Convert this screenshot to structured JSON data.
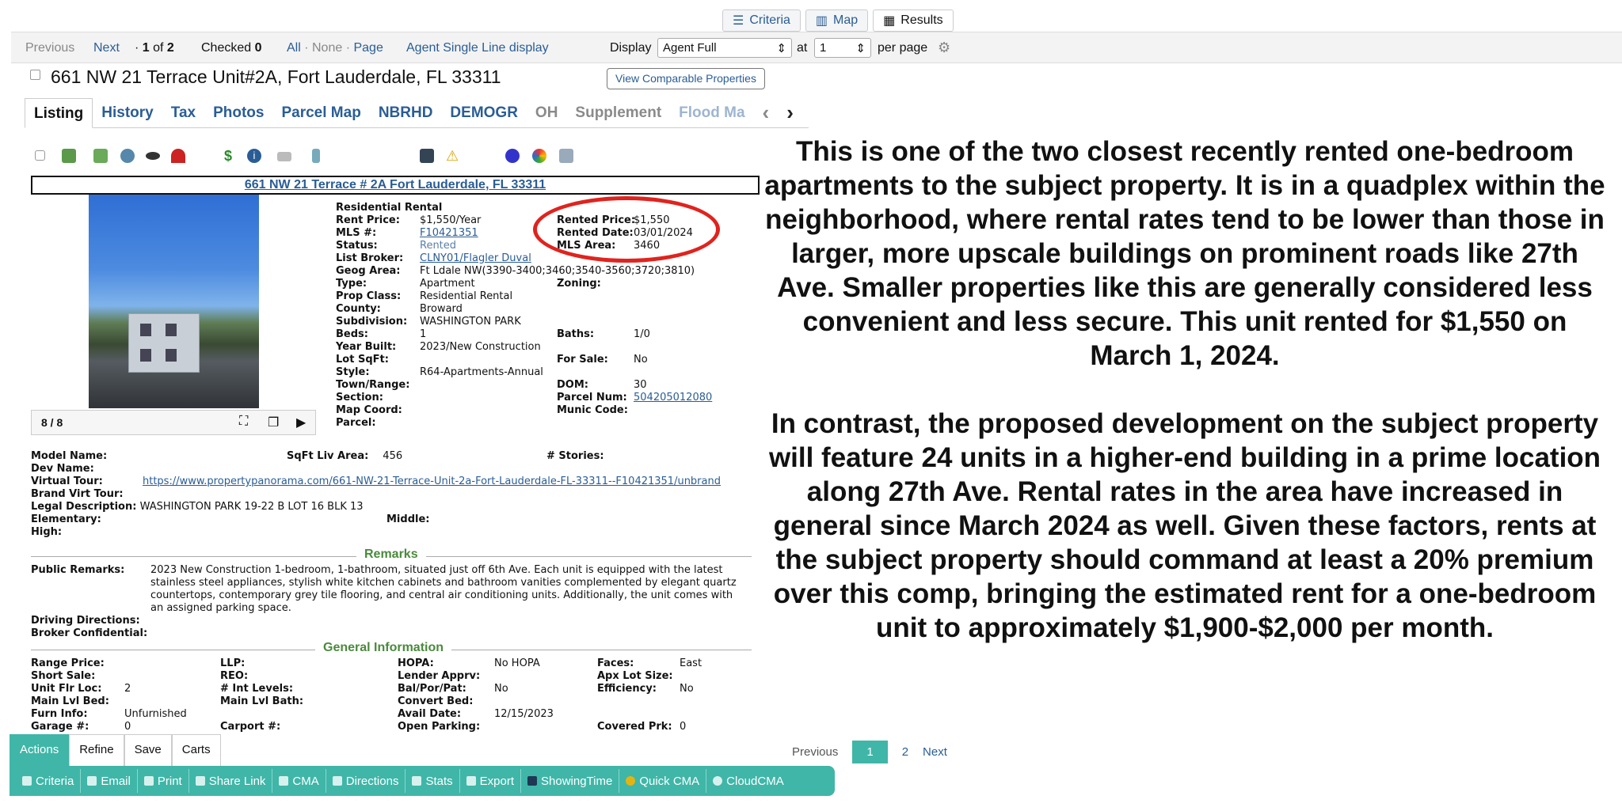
{
  "view_tabs": [
    {
      "label": "Criteria",
      "icon": "sliders-icon"
    },
    {
      "label": "Map",
      "icon": "map-icon"
    },
    {
      "label": "Results",
      "icon": "grid-icon"
    }
  ],
  "toolbar": {
    "previous": "Previous",
    "next": "Next",
    "position_prefix": "· ",
    "position_current": "1",
    "position_of": " of ",
    "position_total": "2",
    "checked_label": "Checked ",
    "checked_count": "0",
    "all": "All",
    "none": "None",
    "page": "Page",
    "sep": " · ",
    "single_line": "Agent Single Line display",
    "display_label": "Display",
    "display_value": "Agent Full",
    "at_label": "at",
    "per_page_value": "1",
    "per_page_label": "per page"
  },
  "listing": {
    "address": "661 NW 21 Terrace Unit#2A, Fort Lauderdale, FL 33311",
    "comparable_button": "View Comparable Properties",
    "tabs": [
      "Listing",
      "History",
      "Tax",
      "Photos",
      "Parcel Map",
      "NBRHD",
      "DEMOGR",
      "OH",
      "Supplement",
      "Flood Ma"
    ],
    "header_link": "661 NW 21 Terrace # 2A Fort Lauderdale, FL 33311",
    "photo_counter": "8 / 8",
    "type_heading": "Residential Rental",
    "col1": [
      {
        "k": "Rent Price:",
        "v": "$1,550/Year"
      },
      {
        "k": "MLS #:",
        "v": "F10421351"
      },
      {
        "k": "Status:",
        "v": "Rented"
      },
      {
        "k": "List Broker:",
        "v": "CLNY01/Flagler Duval"
      },
      {
        "k": "Geog Area:",
        "v": "Ft Ldale NW(3390-3400;3460;3540-3560;3720;3810)"
      },
      {
        "k": "Type:",
        "v": "Apartment"
      },
      {
        "k": "Prop Class:",
        "v": "Residential Rental"
      },
      {
        "k": "County:",
        "v": "Broward"
      },
      {
        "k": "Subdivision:",
        "v": "WASHINGTON PARK"
      },
      {
        "k": "Beds:",
        "v": "1"
      },
      {
        "k": "Year Built:",
        "v": "2023/New Construction"
      },
      {
        "k": "Lot SqFt:",
        "v": ""
      },
      {
        "k": "Style:",
        "v": "R64-Apartments-Annual"
      },
      {
        "k": "Town/Range:",
        "v": ""
      },
      {
        "k": "Section:",
        "v": ""
      },
      {
        "k": "Map Coord:",
        "v": ""
      },
      {
        "k": "Parcel:",
        "v": ""
      }
    ],
    "col2": [
      {
        "k": "Rented Price:",
        "v": "$1,550"
      },
      {
        "k": "Rented Date:",
        "v": "03/01/2024"
      },
      {
        "k": "MLS Area:",
        "v": "3460"
      },
      {
        "k": "",
        "v": ""
      },
      {
        "k": "",
        "v": ""
      },
      {
        "k": "Zoning:",
        "v": ""
      },
      {
        "k": "",
        "v": ""
      },
      {
        "k": "",
        "v": ""
      },
      {
        "k": "",
        "v": ""
      },
      {
        "k": "Baths:",
        "v": "1/0"
      },
      {
        "k": "",
        "v": ""
      },
      {
        "k": "For Sale:",
        "v": "No"
      },
      {
        "k": "",
        "v": ""
      },
      {
        "k": "DOM:",
        "v": "30"
      },
      {
        "k": "Parcel Num:",
        "v": "504205012080"
      },
      {
        "k": "Munic Code:",
        "v": ""
      }
    ],
    "model_name": "Model Name:",
    "sqft_liv_label": "SqFt Liv Area:",
    "sqft_liv": "456",
    "stories_label": "# Stories:",
    "dev_name": "Dev Name:",
    "virtual_tour_label": "Virtual Tour:",
    "virtual_tour": "https://www.propertypanorama.com/661-NW-21-Terrace-Unit-2a-Fort-Lauderdale-FL-33311--F10421351/unbrand",
    "brand_virt": "Brand Virt Tour:",
    "legal_label": "Legal Description:",
    "legal": "WASHINGTON PARK 19-22 B LOT 16 BLK 13",
    "elementary": "Elementary:",
    "middle": "Middle:",
    "high": "High:",
    "remarks_title": "Remarks",
    "public_remarks_label": "Public Remarks:",
    "public_remarks": [
      "2023 New Construction 1-bedroom, 1-bathroom, situated just off 6th Ave. Each unit is equipped with the latest",
      "stainless steel appliances, stylish white kitchen cabinets and bathroom vanities complemented by elegant quartz",
      "countertops, contemporary grey tile flooring, and central air conditioning units. Additionally, the unit comes with",
      "an assigned parking space."
    ],
    "driving": "Driving Directions:",
    "broker_conf": "Broker Confidential:",
    "general_title": "General Information",
    "general": [
      [
        {
          "k": "Range Price:",
          "v": ""
        },
        {
          "k": "LLP:",
          "v": ""
        },
        {
          "k": "HOPA:",
          "v": "No HOPA"
        },
        {
          "k": "Faces:",
          "v": "East"
        }
      ],
      [
        {
          "k": "Short Sale:",
          "v": ""
        },
        {
          "k": "REO:",
          "v": ""
        },
        {
          "k": "Lender Apprv:",
          "v": ""
        },
        {
          "k": "Apx Lot Size:",
          "v": ""
        }
      ],
      [
        {
          "k": "Unit Flr Loc:",
          "v": "2"
        },
        {
          "k": "# Int Levels:",
          "v": ""
        },
        {
          "k": "Bal/Por/Pat:",
          "v": "No"
        },
        {
          "k": "Efficiency:",
          "v": "No"
        }
      ],
      [
        {
          "k": "Main Lvl Bed:",
          "v": ""
        },
        {
          "k": "Main Lvl Bath:",
          "v": ""
        },
        {
          "k": "Convert Bed:",
          "v": ""
        },
        {
          "k": "",
          "v": ""
        }
      ],
      [
        {
          "k": "Furn Info:",
          "v": "Unfurnished"
        },
        {
          "k": "",
          "v": ""
        },
        {
          "k": "Avail Date:",
          "v": "12/15/2023"
        },
        {
          "k": "",
          "v": ""
        }
      ],
      [
        {
          "k": "Garage #:",
          "v": "0"
        },
        {
          "k": "Carport #:",
          "v": ""
        },
        {
          "k": "Open Parking:",
          "v": ""
        },
        {
          "k": "Covered Prk:",
          "v": "0"
        }
      ]
    ]
  },
  "commentary": {
    "para1": "This is one of the two closest recently rented one-bedroom apartments to the subject property. It is in a quadplex within the neighborhood, where rental rates tend to be lower than those in larger, more upscale buildings on prominent roads like 27th Ave. Smaller properties like this are generally considered less convenient and less secure. This unit rented for $1,550 on March 1, 2024.",
    "para2": "In contrast, the proposed development on the subject property will feature 24 units in a higher-end building in a prime location along 27th Ave. Rental rates in the area have increased in general since March 2024 as well. Given these factors, rents at the subject property should command at least a 20% premium over this comp, bringing the estimated rent for a one-bedroom unit to approximately $1,900-$2,000 per month."
  },
  "bottom": {
    "tabs": [
      "Actions",
      "Refine",
      "Save",
      "Carts"
    ],
    "actions": [
      "Criteria",
      "Email",
      "Print",
      "Share Link",
      "CMA",
      "Directions",
      "Stats",
      "Export",
      "ShowingTime",
      "Quick CMA",
      "CloudCMA"
    ],
    "pager": {
      "previous": "Previous",
      "pages": [
        "1",
        "2"
      ],
      "next": "Next"
    }
  }
}
